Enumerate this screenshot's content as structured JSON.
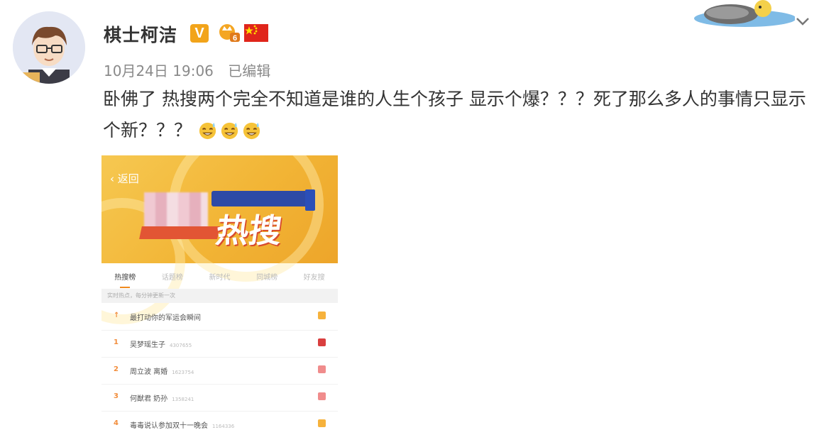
{
  "post": {
    "username": "棋士柯洁",
    "verified_badge": "V",
    "level_badge": "6",
    "date": "10月24日 19:06",
    "edited": "已编辑",
    "text": "卧佛了 热搜两个完全不知道是谁的人生个孩子 显示个爆？？？死了那么多人的事情只显示个新？？？"
  },
  "screenshot": {
    "back_label": "返回",
    "banner_title": "热搜",
    "tabs": [
      {
        "label": "热搜榜",
        "active": true
      },
      {
        "label": "话题榜",
        "active": false
      },
      {
        "label": "新时代",
        "active": false
      },
      {
        "label": "同城榜",
        "active": false
      },
      {
        "label": "好友搜",
        "active": false
      }
    ],
    "notice": "实时热点，每分钟更新一次",
    "rows": [
      {
        "rank": "↑",
        "title": "最打动你的军运会瞬间",
        "count": "",
        "tag_color": "#f6b23c"
      },
      {
        "rank": "1",
        "title": "吴梦瑶生子",
        "count": "4307655",
        "tag_color": "#d93f3f"
      },
      {
        "rank": "2",
        "title": "周立波 离婚",
        "count": "1623754",
        "tag_color": "#f08c8c"
      },
      {
        "rank": "3",
        "title": "何猷君 奶孙",
        "count": "1358241",
        "tag_color": "#f08c8c"
      },
      {
        "rank": "4",
        "title": "毒毒说认参加双十一晚会",
        "count": "1164336",
        "tag_color": "#f6b23c"
      }
    ]
  },
  "colors": {
    "badge_orange": "#f2a41a",
    "flag_red": "#e0251b",
    "meta_gray": "#8a8a8a"
  }
}
